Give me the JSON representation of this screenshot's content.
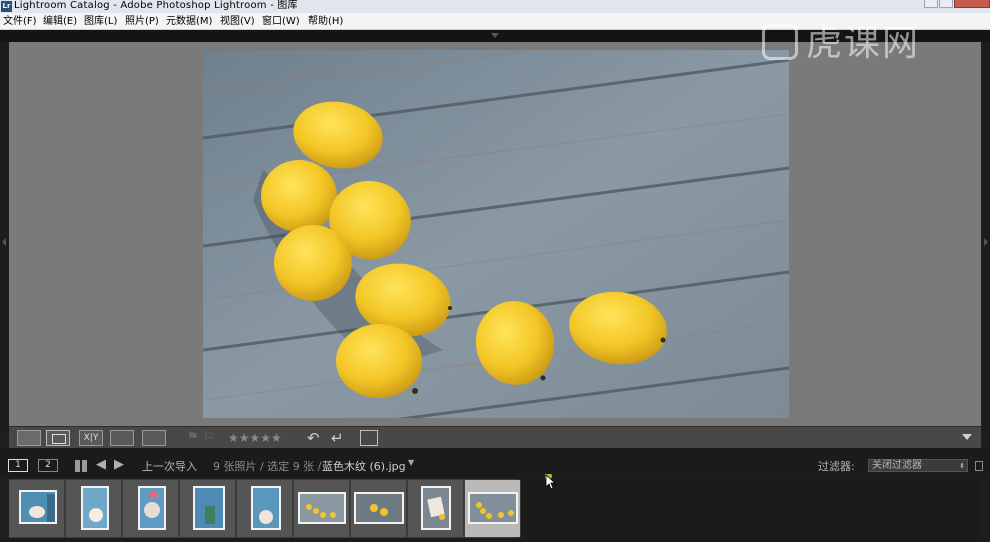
{
  "window": {
    "app_icon": "Lr",
    "title": "Lightroom Catalog - Adobe Photoshop Lightroom - 图库"
  },
  "menu": [
    "文件(F)",
    "编辑(E)",
    "图库(L)",
    "照片(P)",
    "元数据(M)",
    "视图(V)",
    "窗口(W)",
    "帮助(H)"
  ],
  "watermark": {
    "text": "虎课网",
    "icon": "tiger-logo-icon"
  },
  "photo": {
    "description_icon": "lemons-on-wood-photo",
    "colors": {
      "wood": "#7f8f9b",
      "lemon": "#f1c52a"
    }
  },
  "toolbar": {
    "compare_label": "X|Y",
    "stars": "★★★★★",
    "rotate_left": "↶",
    "rotate_right": "↵"
  },
  "filmstrip_header": {
    "screen1": "1",
    "screen2": "2",
    "source": "上一次导入",
    "count": "9 张照片 / 选定 9 张 /",
    "current_file": "蓝色木纹 (6).jpg",
    "filter_label": "过滤器:",
    "filter_value": "关闭过滤器"
  },
  "filmstrip": {
    "thumbnails": [
      {
        "kind": "portrait",
        "selected": false
      },
      {
        "kind": "portrait",
        "selected": false
      },
      {
        "kind": "portrait",
        "selected": false
      },
      {
        "kind": "portrait",
        "selected": false
      },
      {
        "kind": "portrait",
        "selected": false
      },
      {
        "kind": "landscape-lemons",
        "selected": false
      },
      {
        "kind": "landscape-lemons",
        "selected": false
      },
      {
        "kind": "portrait-card",
        "selected": false
      },
      {
        "kind": "landscape-lemons",
        "selected": true
      }
    ]
  }
}
